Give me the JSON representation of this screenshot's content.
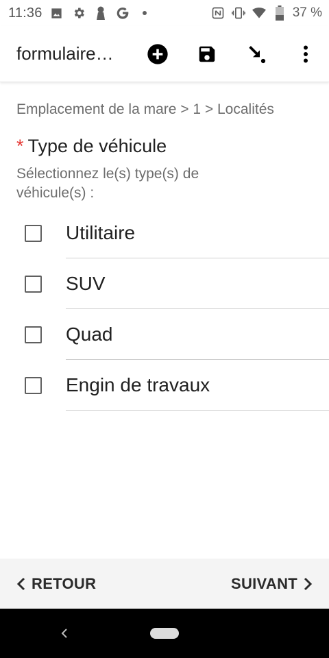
{
  "status_bar": {
    "time": "11:36",
    "battery_text": "37 %",
    "left_icons": [
      "image-icon",
      "settings-icon",
      "keyhole-icon",
      "google-icon",
      "dot-icon"
    ],
    "right_icons": [
      "nfc-icon",
      "vibrate-icon",
      "wifi-icon",
      "battery-icon"
    ]
  },
  "app_bar": {
    "title": "formulaire…",
    "actions": [
      "add-circle-icon",
      "save-icon",
      "go-to-icon",
      "more-vert-icon"
    ]
  },
  "form": {
    "breadcrumb": "Emplacement de la mare > 1 > Localités",
    "required_marker": "*",
    "question": "Type de véhicule",
    "hint": "Sélectionnez le(s) type(s) de véhicule(s) :",
    "options": [
      {
        "label": "Utilitaire",
        "checked": false
      },
      {
        "label": "SUV",
        "checked": false
      },
      {
        "label": "Quad",
        "checked": false
      },
      {
        "label": "Engin de travaux",
        "checked": false
      }
    ]
  },
  "navigation": {
    "back_label": "RETOUR",
    "next_label": "SUIVANT"
  },
  "colors": {
    "required": "#e53935",
    "text_primary": "#212121",
    "text_secondary": "#6d6d6d",
    "bottom_bar": "#f4f4f4",
    "system_nav": "#000000"
  }
}
